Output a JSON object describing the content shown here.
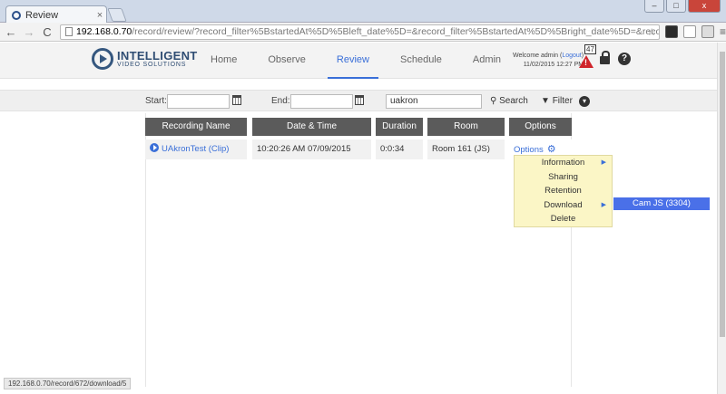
{
  "browser": {
    "tab_title": "Review",
    "tab_close": "×",
    "address_host": "192.168.0.70",
    "address_path": "/record/review/?record_filter%5BstartedAt%5D%5Bleft_date%5D=&record_filter%5BstartedAt%5D%5Bright_date%5D=&record_filter%5Bname%",
    "window_controls": [
      "–",
      "□",
      "x"
    ],
    "back_icon": "←",
    "forward_icon": "→",
    "reload_icon": "C",
    "status_url": "192.168.0.70/record/672/download/5"
  },
  "app": {
    "logo_line1": "INTELLIGENT",
    "logo_line2": "VIDEO SOLUTIONS",
    "nav": [
      "Home",
      "Observe",
      "Review",
      "Schedule",
      "Admin"
    ],
    "welcome_prefix": "Welcome admin (",
    "logout_label": "Logout",
    "welcome_suffix": ")",
    "datetime": "11/02/2015 12:27 PM",
    "alert_count": "47",
    "help_symbol": "?"
  },
  "filter": {
    "start_label": "Start:",
    "start_value": "",
    "end_label": "End:",
    "end_value": "",
    "search_value": "uakron",
    "search_label": "Search",
    "filter_label": "Filter"
  },
  "table": {
    "headers": [
      "Recording Name",
      "Date & Time",
      "Duration",
      "Room",
      "Options"
    ],
    "rows": [
      {
        "name": "UAkronTest (Clip)",
        "datetime": "10:20:26 AM 07/09/2015",
        "duration": "0:0:34",
        "room": "Room 161 (JS)",
        "options": "Options"
      }
    ]
  },
  "options_menu": {
    "items": [
      "Information",
      "Sharing",
      "Retention",
      "Download",
      "Delete"
    ],
    "submenu_item": "Cam JS (3304)"
  },
  "colors": {
    "accent": "#3a6fd8",
    "header_bg": "#5b5b5b",
    "menu_bg": "#fbf6c6",
    "alert": "#d0242b"
  }
}
